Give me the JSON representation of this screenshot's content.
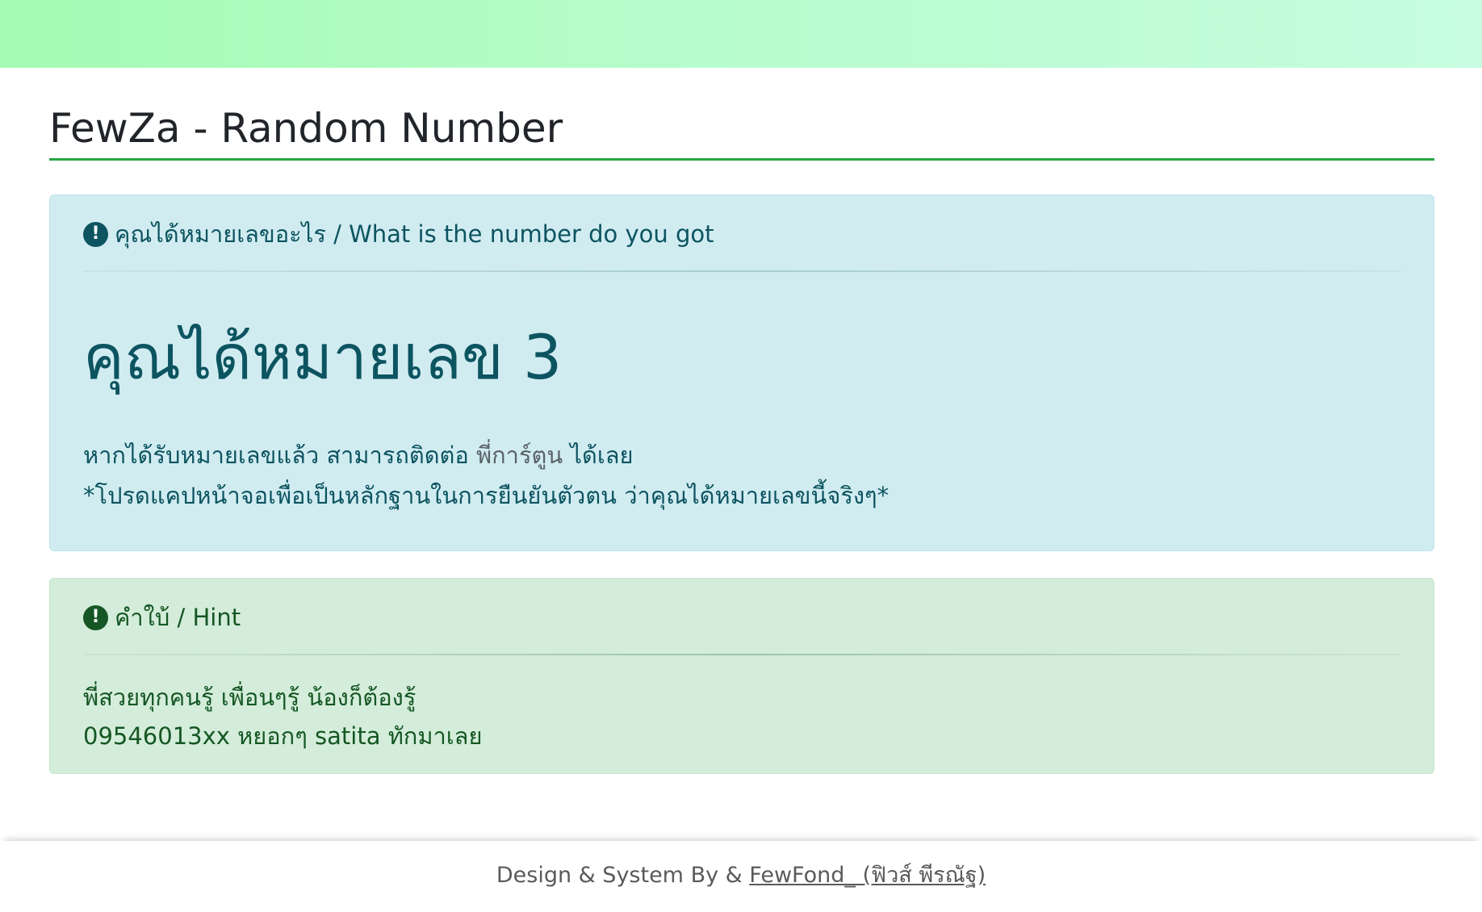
{
  "header": {
    "title": "FewZa - Random Number"
  },
  "result_card": {
    "icon": "exclamation-circle-icon",
    "heading": "คุณได้หมายเลขอะไร / What is the number do you got",
    "number_text": "คุณได้หมายเลข 3",
    "contact_prefix": "หากได้รับหมายเลขแล้ว สามารถติดต่อ ",
    "contact_link": "พี่การ์ตูน",
    "contact_suffix": " ได้เลย",
    "note": "*โปรดแคปหน้าจอเพื่อเป็นหลักฐานในการยืนยันตัวตน ว่าคุณได้หมายเลขนี้จริงๆ*"
  },
  "hint_card": {
    "icon": "exclamation-circle-icon",
    "heading": "คำใบ้ / Hint",
    "line1": "พี่สวยทุกคนรู้ เพื่อนๆรู้ น้องก็ต้องรู้",
    "line2": "09546013xx หยอกๆ satita ทักมาเลย"
  },
  "footer": {
    "prefix": "Design & System By & ",
    "author_link": "FewFond_ (ฟิวส์ พีรณัฐ)"
  },
  "colors": {
    "accent": "#28a745",
    "info_bg": "#d1ecf1",
    "info_text": "#0c5460",
    "success_bg": "#d4edda",
    "success_text": "#155724"
  }
}
